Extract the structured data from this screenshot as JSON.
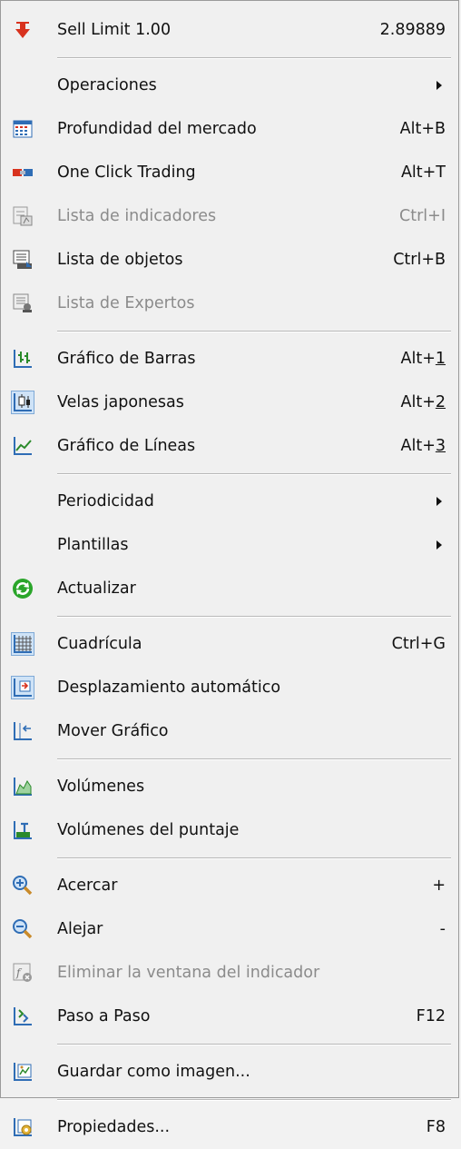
{
  "menu": {
    "sell_limit": {
      "label": "Sell Limit 1.00",
      "value": "2.89889",
      "icon": "sell-arrow-icon"
    },
    "operaciones": {
      "label": "Operaciones"
    },
    "profundidad": {
      "label": "Profundidad del mercado",
      "accel": "Alt+B",
      "icon": "market-depth-icon"
    },
    "one_click": {
      "label": "One Click Trading",
      "accel": "Alt+T",
      "icon": "one-click-icon"
    },
    "lista_indicadores": {
      "label": "Lista de indicadores",
      "accel": "Ctrl+I",
      "icon": "indicators-list-icon",
      "disabled": true
    },
    "lista_objetos": {
      "label": "Lista de objetos",
      "accel": "Ctrl+B",
      "icon": "objects-list-icon"
    },
    "lista_expertos": {
      "label": "Lista de Expertos",
      "icon": "experts-list-icon",
      "disabled": true
    },
    "grafico_barras": {
      "label": "Gráfico de Barras",
      "accel_prefix": "Alt+",
      "accel_key": "1",
      "icon": "bar-chart-icon"
    },
    "velas": {
      "label": "Velas japonesas",
      "accel_prefix": "Alt+",
      "accel_key": "2",
      "icon": "candlestick-icon",
      "checked": true
    },
    "grafico_lineas": {
      "label": "Gráfico de Líneas",
      "accel_prefix": "Alt+",
      "accel_key": "3",
      "icon": "line-chart-icon"
    },
    "periodicidad": {
      "label": "Periodicidad"
    },
    "plantillas": {
      "label": "Plantillas"
    },
    "actualizar": {
      "label": "Actualizar",
      "icon": "refresh-icon"
    },
    "cuadricula": {
      "label": "Cuadrícula",
      "accel": "Ctrl+G",
      "icon": "grid-icon",
      "checked": true
    },
    "desplazamiento": {
      "label": "Desplazamiento automático",
      "icon": "auto-scroll-icon",
      "checked": true
    },
    "mover": {
      "label": "Mover Gráfico",
      "icon": "chart-shift-icon"
    },
    "volumenes": {
      "label": "Volúmenes",
      "icon": "volumes-icon"
    },
    "volumenes_puntaje": {
      "label": "Volúmenes del puntaje",
      "icon": "tick-volumes-icon"
    },
    "acercar": {
      "label": "Acercar",
      "accel": "+",
      "icon": "zoom-in-icon"
    },
    "alejar": {
      "label": "Alejar",
      "accel": "-",
      "icon": "zoom-out-icon"
    },
    "eliminar": {
      "label": "Eliminar la ventana del indicador",
      "icon": "delete-indicator-window-icon",
      "disabled": true
    },
    "paso": {
      "label": "Paso a Paso",
      "accel": "F12",
      "icon": "step-by-step-icon"
    },
    "guardar": {
      "label": "Guardar como imagen...",
      "icon": "save-image-icon"
    },
    "propiedades": {
      "label": "Propiedades...",
      "accel": "F8",
      "icon": "properties-icon"
    }
  },
  "colors": {
    "menu_bg": "#f0f0f0",
    "disabled_text": "#8b8b8b",
    "checked_bg": "#cfe3f7",
    "accent_blue": "#2f6db5",
    "sell_red": "#d8321e",
    "refresh_green": "#2aa52a"
  }
}
